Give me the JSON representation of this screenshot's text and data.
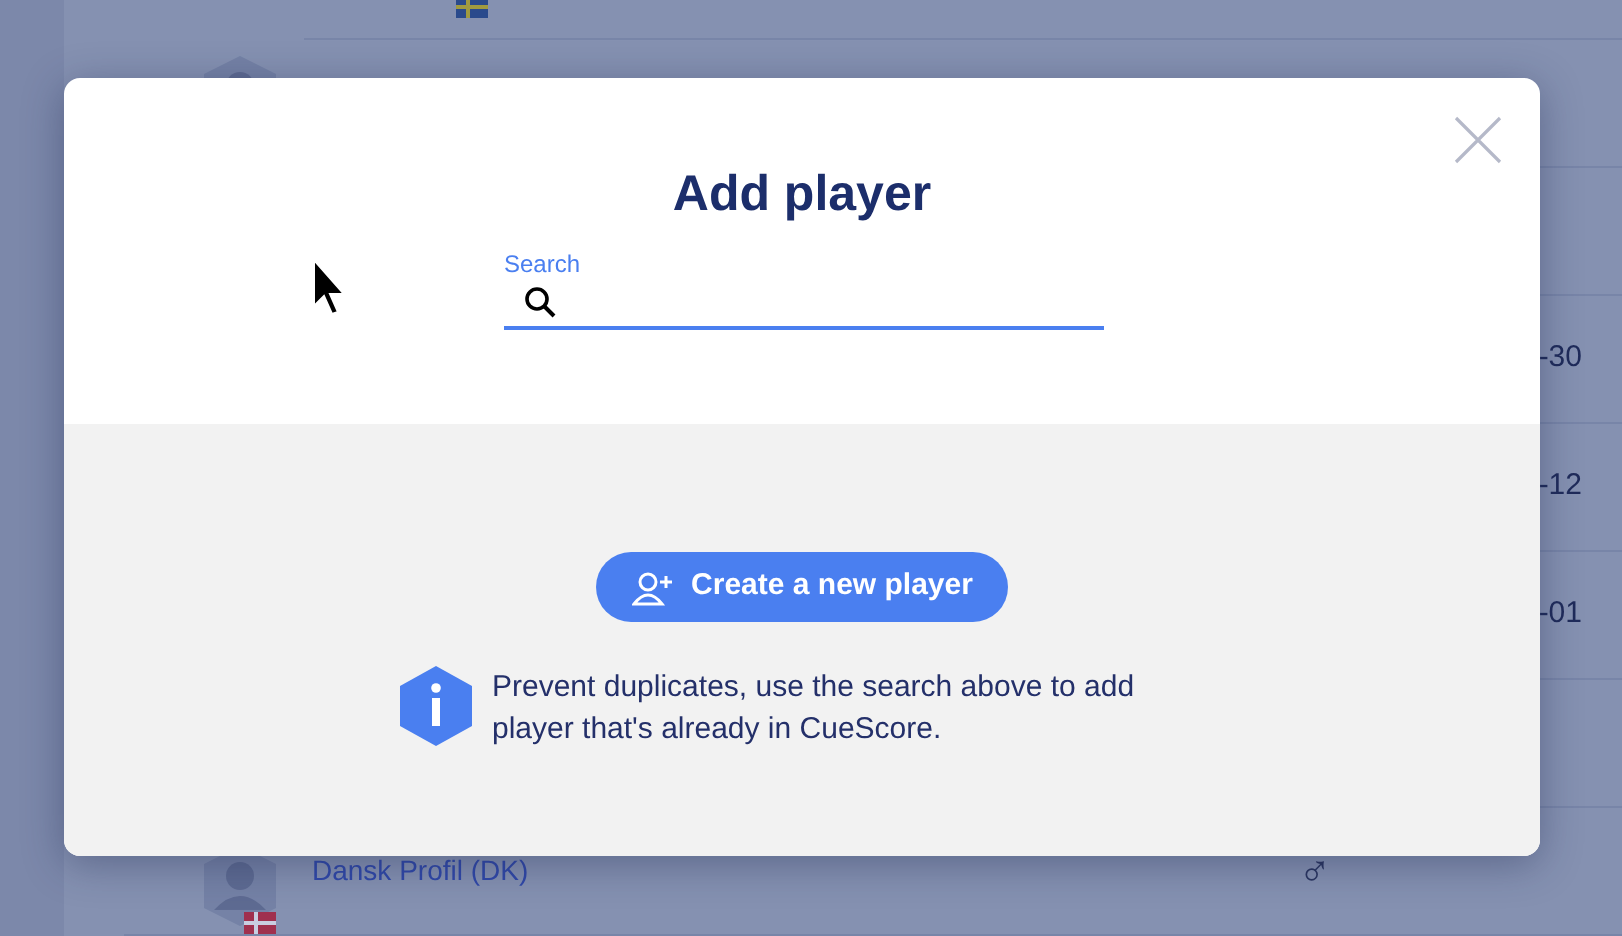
{
  "background_rows": [
    {
      "kind": "flag",
      "flag": {
        "kind": "se"
      }
    },
    {
      "kind": "avatar"
    },
    {
      "kind": "blank"
    },
    {
      "kind": "value",
      "value": "-30"
    },
    {
      "kind": "value",
      "value": "-12"
    },
    {
      "kind": "value",
      "value": "-01"
    },
    {
      "kind": "blank"
    },
    {
      "kind": "player",
      "name": "Dansk Profil (DK)",
      "gender": "♂",
      "flag": {
        "kind": "dk"
      }
    }
  ],
  "dialog": {
    "title": "Add player",
    "search": {
      "label": "Search",
      "focused": true
    },
    "create_button": "Create a new player",
    "info": "Prevent duplicates, use the search above to add player that's already in CueScore."
  }
}
